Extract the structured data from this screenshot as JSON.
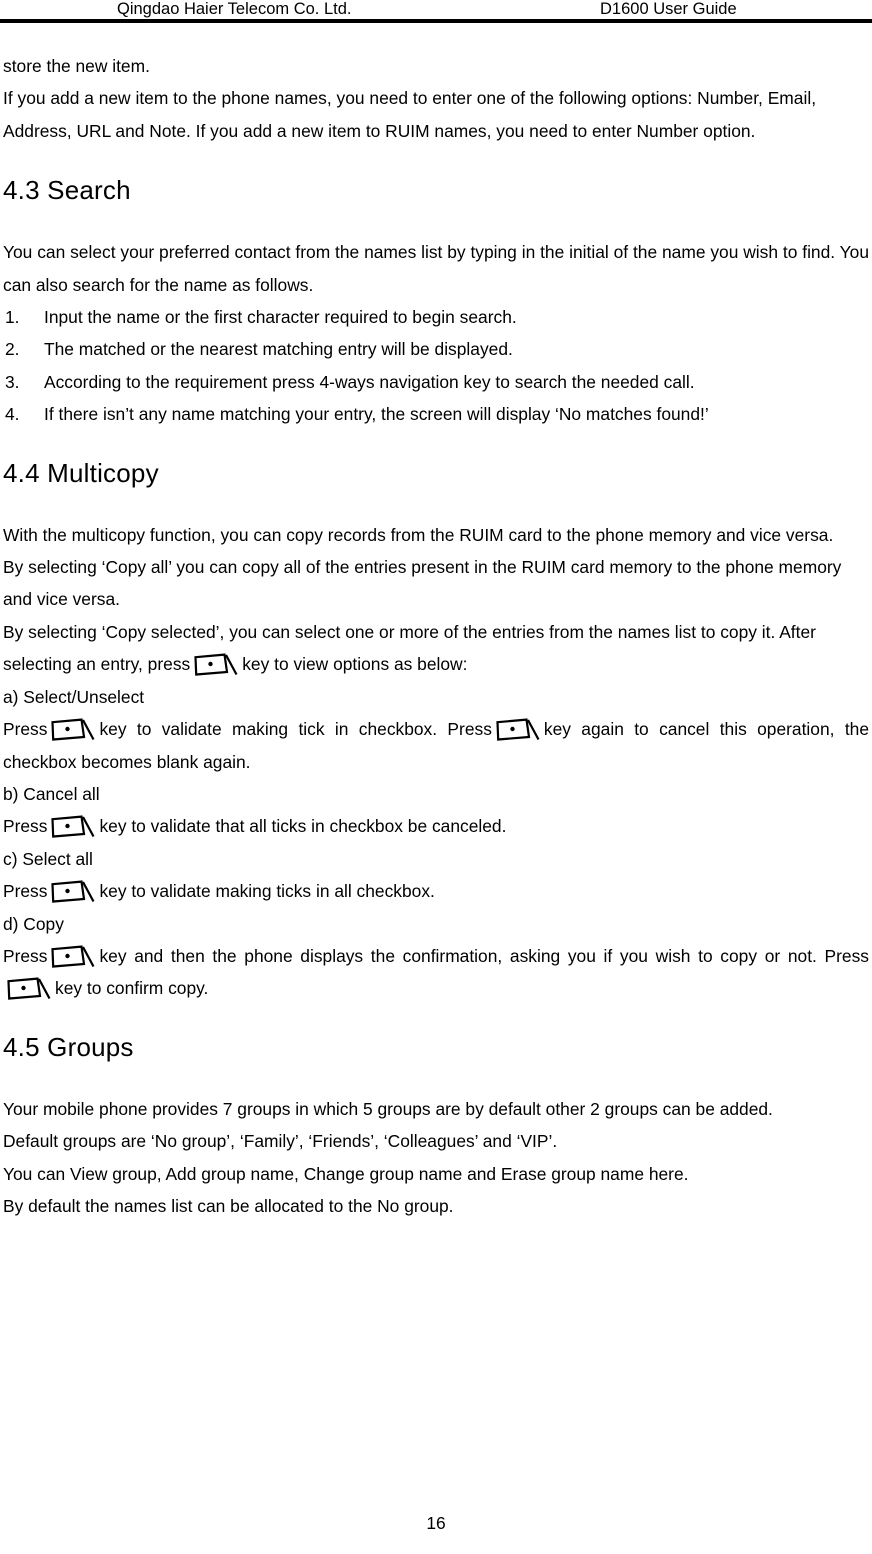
{
  "header": {
    "left": "Qingdao Haier Telecom Co. Ltd.",
    "right": "D1600 User Guide"
  },
  "footer": {
    "page_number": "16"
  },
  "icons": {
    "ok_key": "keycap-dot-icon"
  },
  "body": {
    "intro": {
      "line1": "store the new item.",
      "line2": "If you add a new item to the phone names, you need to enter one of the following options: Number, Email, Address, URL and Note. If you add a new item to RUIM names, you need to enter Number option."
    },
    "section_search": {
      "heading": "4.3 Search",
      "para1": "You can select your preferred contact from the names list by typing in the initial of the name you wish to find. You can also search for the name as follows.",
      "steps": [
        {
          "num": "1.",
          "text": "Input the name or the first character required to begin search."
        },
        {
          "num": "2.",
          "text": "The matched or the nearest matching entry will be displayed."
        },
        {
          "num": "3.",
          "text": "According to the requirement press 4-ways navigation key to search the needed call."
        },
        {
          "num": "4.",
          "text": "If there isn’t any name matching your entry, the screen will display ‘No matches found!’"
        }
      ]
    },
    "section_multicopy": {
      "heading": "4.4 Multicopy",
      "para1": "With the multicopy function, you can copy records from the RUIM card to the phone memory and vice versa.",
      "para2": "By selecting ‘Copy all’ you can copy all of the entries present in the RUIM card memory to the phone memory and vice versa.",
      "para3_a": "By selecting ‘Copy selected’, you can select one or more of the entries from the names list to copy it. After selecting an entry, press",
      "para3_b": "key to view options as below:",
      "opt_a": {
        "label": "a) Select/Unselect",
        "t1": "Press",
        "t2": "key to validate making tick in checkbox. Press",
        "t3": "key again to cancel this operation, the checkbox becomes blank again."
      },
      "opt_b": {
        "label": "b) Cancel all",
        "t1": "Press",
        "t2": "key to validate that all ticks in checkbox be canceled."
      },
      "opt_c": {
        "label": "c) Select all",
        "t1": "Press",
        "t2": "key to validate making ticks in all checkbox."
      },
      "opt_d": {
        "label": "d) Copy",
        "t1": "Press",
        "t2": "key and then the phone displays the confirmation, asking you if you wish to copy or not. Press",
        "t3": "key to confirm copy."
      }
    },
    "section_groups": {
      "heading": "4.5 Groups",
      "para1": "Your mobile phone provides 7 groups in which 5 groups are by default other 2 groups can be added.",
      "para2": "Default groups are ‘No group’, ‘Family’, ‘Friends’, ‘Colleagues’ and ‘VIP’.",
      "para3": "You can View group, Add group name, Change group name and Erase group name here.",
      "para4": "By default the names list can be allocated to the No group."
    }
  }
}
